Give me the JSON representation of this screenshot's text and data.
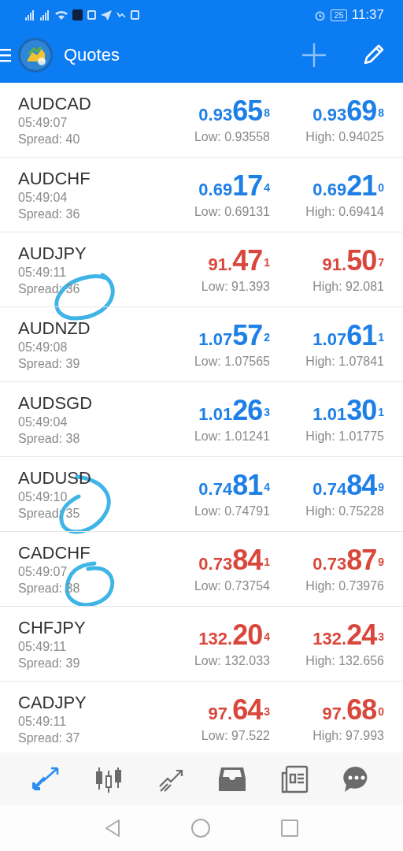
{
  "status_bar": {
    "battery": "25",
    "time": "11:37"
  },
  "header": {
    "title": "Quotes"
  },
  "quotes": [
    {
      "symbol": "AUDCAD",
      "time": "05:49:07",
      "spread": "Spread: 40",
      "color": "#1e7fe6",
      "bid": {
        "prefix": "0.93",
        "big": "65",
        "sup": "8"
      },
      "ask": {
        "prefix": "0.93",
        "big": "69",
        "sup": "8"
      },
      "low": "Low: 0.93558",
      "high": "High: 0.94025"
    },
    {
      "symbol": "AUDCHF",
      "time": "05:49:04",
      "spread": "Spread: 36",
      "color": "#1e7fe6",
      "bid": {
        "prefix": "0.69",
        "big": "17",
        "sup": "4"
      },
      "ask": {
        "prefix": "0.69",
        "big": "21",
        "sup": "0"
      },
      "low": "Low: 0.69131",
      "high": "High: 0.69414"
    },
    {
      "symbol": "AUDJPY",
      "time": "05:49:11",
      "spread": "Spread: 36",
      "color": "#d9473c",
      "bid": {
        "prefix": "91.",
        "big": "47",
        "sup": "1"
      },
      "ask": {
        "prefix": "91.",
        "big": "50",
        "sup": "7"
      },
      "low": "Low: 91.393",
      "high": "High: 92.081"
    },
    {
      "symbol": "AUDNZD",
      "time": "05:49:08",
      "spread": "Spread: 39",
      "color": "#1e7fe6",
      "bid": {
        "prefix": "1.07",
        "big": "57",
        "sup": "2"
      },
      "ask": {
        "prefix": "1.07",
        "big": "61",
        "sup": "1"
      },
      "low": "Low: 1.07565",
      "high": "High: 1.07841"
    },
    {
      "symbol": "AUDSGD",
      "time": "05:49:04",
      "spread": "Spread: 38",
      "color": "#1e7fe6",
      "bid": {
        "prefix": "1.01",
        "big": "26",
        "sup": "3"
      },
      "ask": {
        "prefix": "1.01",
        "big": "30",
        "sup": "1"
      },
      "low": "Low: 1.01241",
      "high": "High: 1.01775"
    },
    {
      "symbol": "AUDUSD",
      "time": "05:49:10",
      "spread": "Spread: 35",
      "color": "#1e7fe6",
      "bid": {
        "prefix": "0.74",
        "big": "81",
        "sup": "4"
      },
      "ask": {
        "prefix": "0.74",
        "big": "84",
        "sup": "9"
      },
      "low": "Low: 0.74791",
      "high": "High: 0.75228"
    },
    {
      "symbol": "CADCHF",
      "time": "05:49:07",
      "spread": "Spread: 38",
      "color": "#d9473c",
      "bid": {
        "prefix": "0.73",
        "big": "84",
        "sup": "1"
      },
      "ask": {
        "prefix": "0.73",
        "big": "87",
        "sup": "9"
      },
      "low": "Low: 0.73754",
      "high": "High: 0.73976"
    },
    {
      "symbol": "CHFJPY",
      "time": "05:49:11",
      "spread": "Spread: 39",
      "color": "#d9473c",
      "bid": {
        "prefix": "132.",
        "big": "20",
        "sup": "4"
      },
      "ask": {
        "prefix": "132.",
        "big": "24",
        "sup": "3"
      },
      "low": "Low: 132.033",
      "high": "High: 132.656"
    },
    {
      "symbol": "CADJPY",
      "time": "05:49:11",
      "spread": "Spread: 37",
      "color": "#d9473c",
      "bid": {
        "prefix": "97.",
        "big": "64",
        "sup": "3"
      },
      "ask": {
        "prefix": "97.",
        "big": "68",
        "sup": "0"
      },
      "low": "Low: 97.522",
      "high": "High: 97.993"
    }
  ],
  "bottom_nav": [
    {
      "kind": "quotes",
      "selected": true
    },
    {
      "kind": "chart",
      "selected": false
    },
    {
      "kind": "trade",
      "selected": false
    },
    {
      "kind": "history",
      "selected": false
    },
    {
      "kind": "news",
      "selected": false
    },
    {
      "kind": "chat",
      "selected": false
    }
  ]
}
